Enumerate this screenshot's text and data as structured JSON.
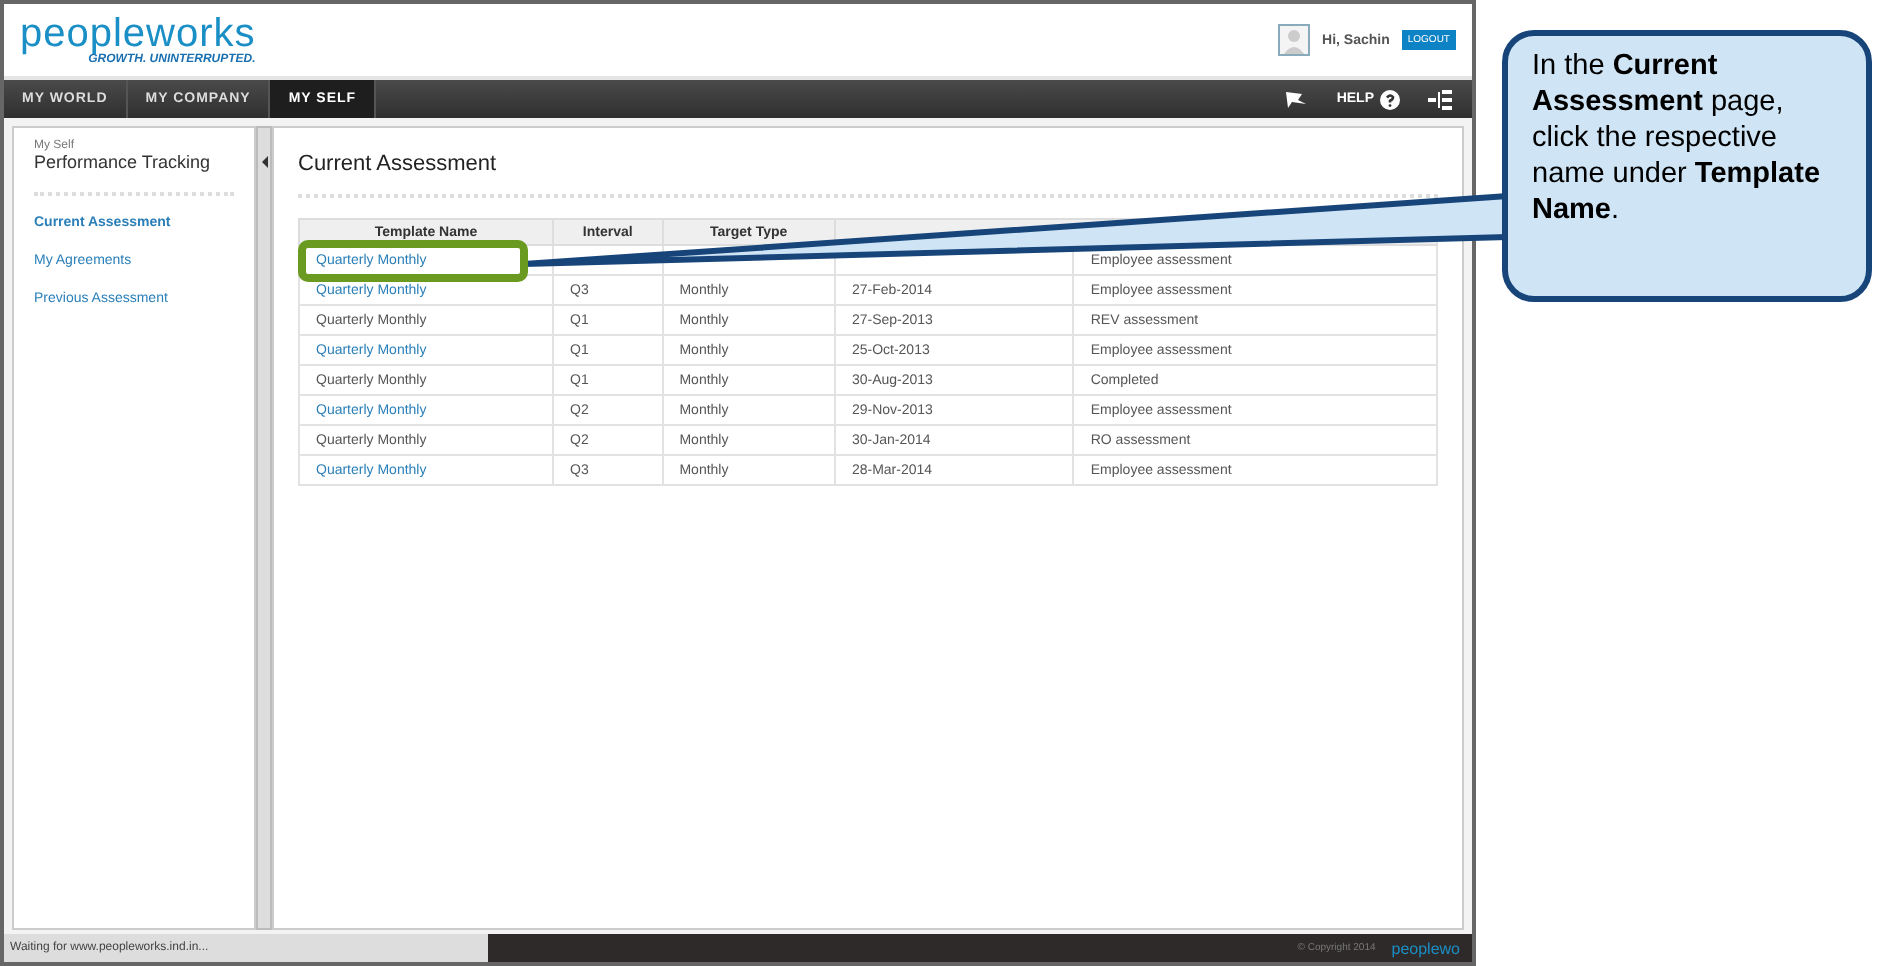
{
  "header": {
    "logo": "peopleworks",
    "tagline": "GROWTH. UNINTERRUPTED.",
    "greeting": "Hi, Sachin",
    "logout": "LOGOUT"
  },
  "nav": {
    "tabs": [
      {
        "label": "MY WORLD",
        "selected": false
      },
      {
        "label": "MY COMPANY",
        "selected": false
      },
      {
        "label": "MY SELF",
        "selected": true
      }
    ],
    "help": "HELP"
  },
  "sidebar": {
    "breadcrumb": "My Self",
    "title": "Performance Tracking",
    "items": [
      {
        "label": "Current Assessment",
        "selected": true
      },
      {
        "label": "My Agreements",
        "selected": false
      },
      {
        "label": "Previous Assessment",
        "selected": false
      }
    ]
  },
  "page_title": "Current Assessment",
  "table": {
    "columns": [
      "Template Name",
      "Interval",
      "Target Type"
    ],
    "rows": [
      {
        "link": true,
        "cells": [
          "Quarterly Monthly",
          null,
          null,
          null,
          "Employee assessment"
        ]
      },
      {
        "link": true,
        "cells": [
          "Quarterly Monthly",
          "Q3",
          "Monthly",
          "27-Feb-2014",
          "Employee assessment"
        ]
      },
      {
        "link": false,
        "cells": [
          "Quarterly Monthly",
          "Q1",
          "Monthly",
          "27-Sep-2013",
          "REV assessment"
        ]
      },
      {
        "link": true,
        "cells": [
          "Quarterly Monthly",
          "Q1",
          "Monthly",
          "25-Oct-2013",
          "Employee assessment"
        ]
      },
      {
        "link": false,
        "cells": [
          "Quarterly Monthly",
          "Q1",
          "Monthly",
          "30-Aug-2013",
          "Completed"
        ]
      },
      {
        "link": true,
        "cells": [
          "Quarterly Monthly",
          "Q2",
          "Monthly",
          "29-Nov-2013",
          "Employee assessment"
        ]
      },
      {
        "link": false,
        "cells": [
          "Quarterly Monthly",
          "Q2",
          "Monthly",
          "30-Jan-2014",
          "RO assessment"
        ]
      },
      {
        "link": true,
        "cells": [
          "Quarterly Monthly",
          "Q3",
          "Monthly",
          "28-Mar-2014",
          "Employee assessment"
        ]
      }
    ]
  },
  "footer": {
    "copyright": "© Copyright 2014",
    "logo": "peoplewo"
  },
  "status_bar": "Waiting for www.peopleworks.ind.in...",
  "callout": "In the **Current Assessment** page, click the respective name under **Template Name**."
}
